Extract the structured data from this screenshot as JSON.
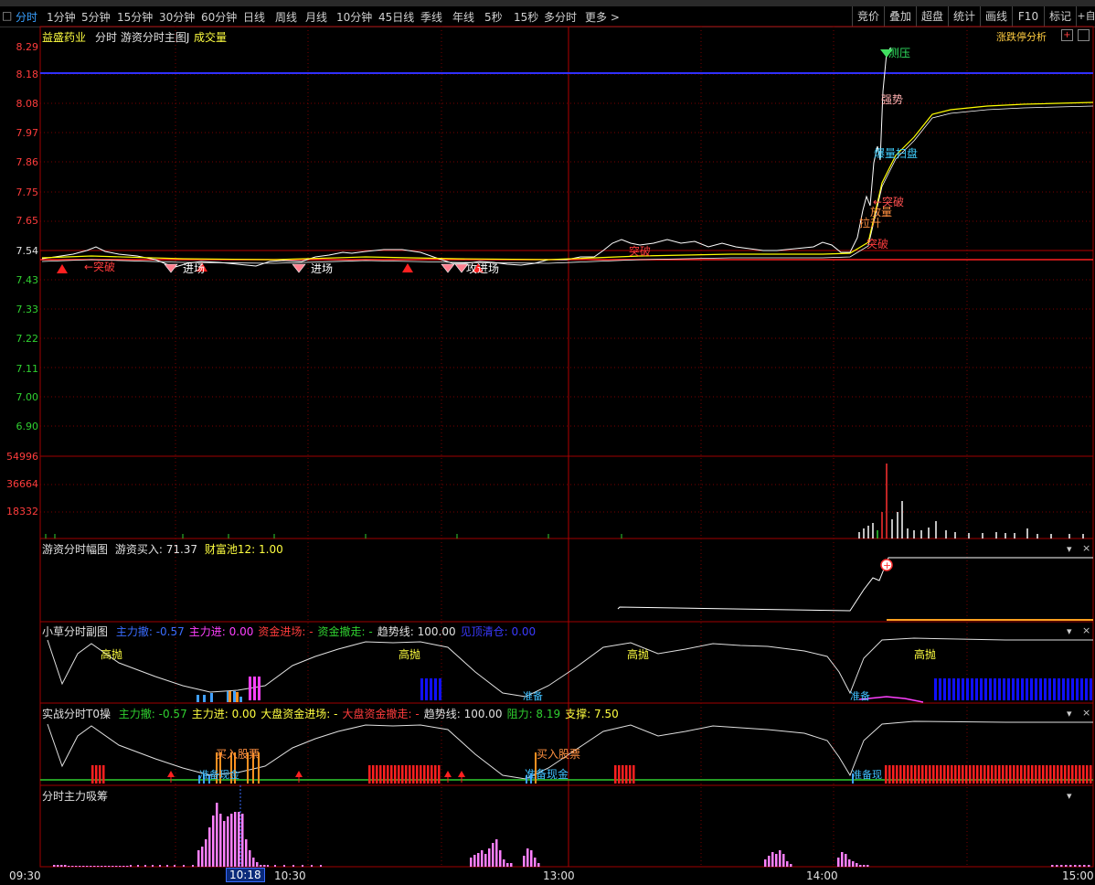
{
  "toolbar": {
    "tabs": [
      "分时",
      "1分钟",
      "5分钟",
      "15分钟",
      "30分钟",
      "60分钟",
      "日线",
      "周线",
      "月线",
      "10分钟",
      "45日线",
      "季线",
      "年线",
      "5秒",
      "15秒",
      "多分时",
      "更多 >"
    ],
    "active": 0,
    "right": [
      "竞价",
      "叠加",
      "超盘",
      "统计",
      "画线",
      "F10",
      "标记",
      "+自"
    ]
  },
  "main_panel": {
    "stock_name": "益盛药业",
    "title": "分时 游资分时主图J",
    "volume_label": "成交量",
    "analysis_label": "涨跌停分析"
  },
  "price_axis": {
    "labels": [
      "8.29",
      "8.18",
      "8.08",
      "7.97",
      "7.86",
      "7.75",
      "7.65",
      "7.54",
      "7.43",
      "7.33",
      "7.22",
      "7.11",
      "7.00",
      "6.90"
    ],
    "pivot_index": 7
  },
  "volume_axis": {
    "labels": [
      "54996",
      "36664",
      "18332"
    ]
  },
  "annotations": {
    "break_a": "←突破",
    "entry": "进场",
    "attack": "攻",
    "break_b": "突破",
    "pressure": "测压",
    "strong": "强势",
    "sweep": "爆量扫盘",
    "break_up": "←突破",
    "vol_up": "放量",
    "rise": "拉升",
    "break_c": "突破"
  },
  "sub1": {
    "title": "游资分时幅图",
    "label1": "游资买入: ",
    "value1": "71.37",
    "label2": "财富池12: ",
    "value2": "1.00"
  },
  "sub2": {
    "title": "小草分时副图",
    "items": [
      {
        "label": "主力撤: ",
        "value": "-0.57",
        "color": "#3a6cff"
      },
      {
        "label": "主力进: ",
        "value": "0.00",
        "color": "#ff40ff"
      },
      {
        "label": "资金进场: ",
        "value": "-",
        "color": "#ff3c3c"
      },
      {
        "label": "资金撤走: ",
        "value": "-",
        "color": "#30d030"
      },
      {
        "label": "趋势线: ",
        "value": "100.00",
        "color": "#e0e0e0"
      },
      {
        "label": "见顶清仓: ",
        "value": "0.00",
        "color": "#3a3aff"
      }
    ],
    "high_sell": "高抛",
    "prepare": "准备"
  },
  "sub3": {
    "title": "实战分时T0操",
    "items": [
      {
        "label": "主力撤: ",
        "value": "-0.57",
        "color": "#30d030"
      },
      {
        "label": "主力进: ",
        "value": "0.00",
        "color": "#ffff40"
      },
      {
        "label": "大盘资金进场: ",
        "value": "-",
        "color": "#ffff40"
      },
      {
        "label": "大盘资金撤走: ",
        "value": "-",
        "color": "#ff3c3c"
      },
      {
        "label": "趋势线: ",
        "value": "100.00",
        "color": "#e0e0e0"
      },
      {
        "label": "阻力: ",
        "value": "8.19",
        "color": "#30d030"
      },
      {
        "label": "支撑: ",
        "value": "7.50",
        "color": "#ffff40"
      }
    ],
    "buy": "买入股票",
    "prepare_cash": "准备现金",
    "prepare": "准备现"
  },
  "sub4": {
    "title": "分时主力吸筹"
  },
  "time_axis": {
    "labels": [
      "09:30",
      "10:30",
      "13:00",
      "14:00",
      "15:00"
    ],
    "cursor": "10:18"
  },
  "colors": {
    "price_up": "#ff3c3c",
    "price_down": "#30d030",
    "grid": "#7a0000",
    "price_line": "#ffffff",
    "avg_line": "#ffff00"
  }
}
